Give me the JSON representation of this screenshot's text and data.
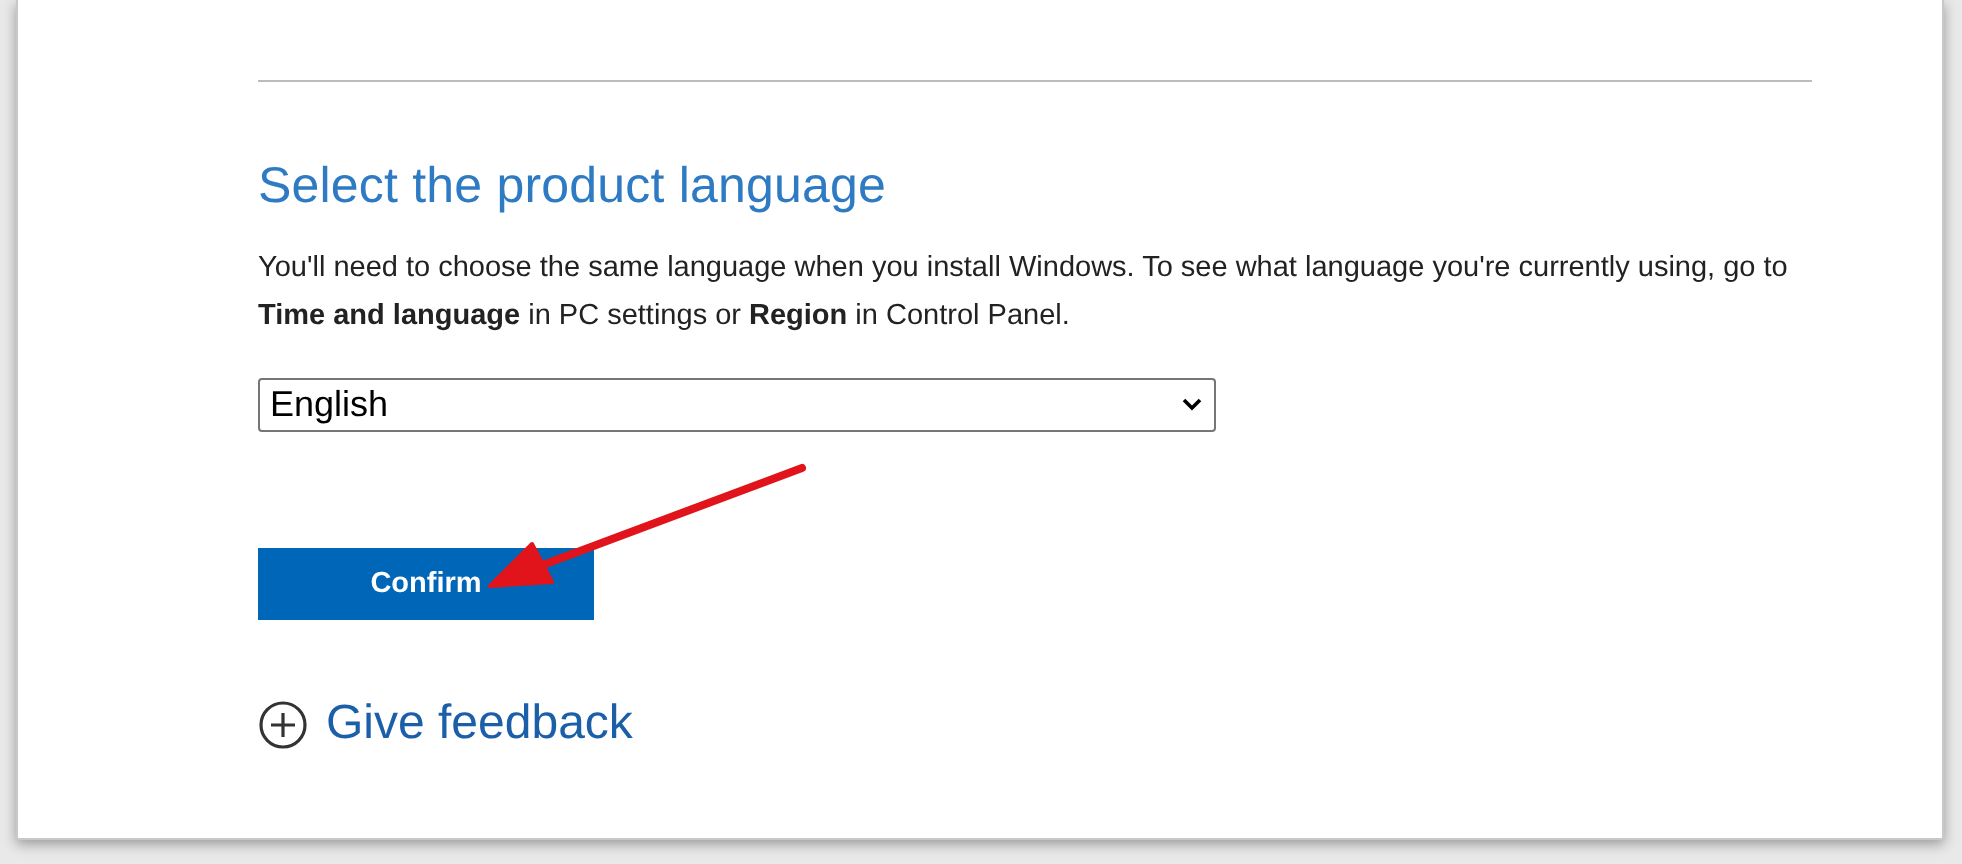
{
  "section": {
    "title": "Select the product language",
    "description": "You'll need to choose the same language when you install Windows. To see what language you're currently using, go to **Time and language** in PC settings or **Region** in Control Panel.",
    "language_select": {
      "value": "English"
    },
    "confirm_button": {
      "label": "Confirm"
    },
    "feedback_link": {
      "label": "Give feedback"
    }
  }
}
